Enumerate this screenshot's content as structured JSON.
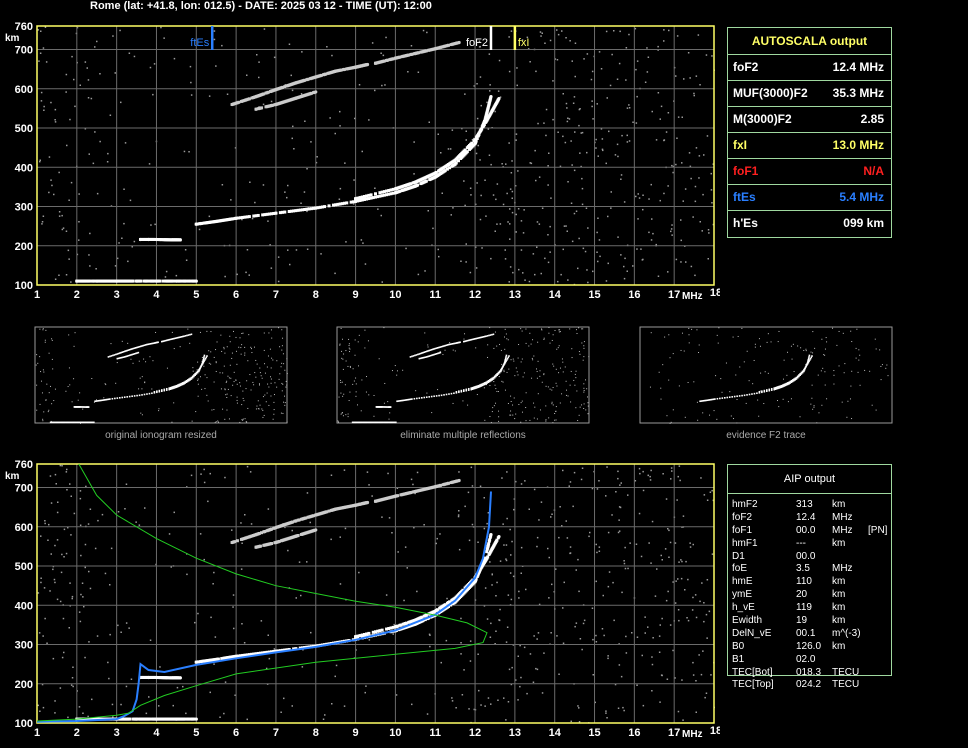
{
  "header": "Rome (lat: +41.8, lon: 012.5) - DATE: 2025 03 12 - TIME (UT): 12:00",
  "colors": {
    "frame": "#ffff66",
    "grid": "#6b6b6b",
    "panel_border": "#9fd89f",
    "blue": "#2a7fff",
    "red": "#ff2020",
    "yellow": "#ffff66",
    "green": "#22cc22"
  },
  "autoscala": {
    "title": "AUTOSCALA output",
    "rows": [
      {
        "label": "foF2",
        "value": "12.4 MHz",
        "color": "#ffffff"
      },
      {
        "label": "MUF(3000)F2",
        "value": "35.3 MHz",
        "color": "#ffffff"
      },
      {
        "label": "M(3000)F2",
        "value": "2.85",
        "color": "#ffffff"
      },
      {
        "label": "fxI",
        "value": "13.0 MHz",
        "color": "#ffff66"
      },
      {
        "label": "foF1",
        "value": "N/A",
        "color": "#ff2020"
      },
      {
        "label": "ftEs",
        "value": "5.4 MHz",
        "color": "#2a7fff"
      },
      {
        "label": "h'Es",
        "value": "099    km",
        "color": "#ffffff"
      }
    ]
  },
  "aip": {
    "title": "AIP output",
    "rows": [
      [
        "hmF2",
        "313",
        "km",
        ""
      ],
      [
        "foF2",
        "12.4",
        "MHz",
        ""
      ],
      [
        "foF1",
        "00.0",
        "MHz",
        "[PN]"
      ],
      [
        "hmF1",
        "---",
        "km",
        ""
      ],
      [
        "D1",
        "00.0",
        "",
        ""
      ],
      [
        "foE",
        "3.5",
        "MHz",
        ""
      ],
      [
        "hmE",
        "110",
        "km",
        ""
      ],
      [
        "ymE",
        "20",
        "km",
        ""
      ],
      [
        "h_vE",
        "119",
        "km",
        ""
      ],
      [
        "Ewidth",
        "19",
        "km",
        ""
      ],
      [
        "DelN_vE",
        "00.1",
        "m^(-3)",
        ""
      ],
      [
        "B0",
        "126.0",
        "km",
        ""
      ],
      [
        "B1",
        "02.0",
        "",
        ""
      ],
      [
        "TEC[Bot]",
        "018.3",
        "TECU",
        ""
      ],
      [
        "TEC[Top]",
        "024.2",
        "TECU",
        ""
      ]
    ]
  },
  "thumbnails": {
    "labels": [
      "original ionogram resized",
      "eliminate multiple reflections",
      "evidence F2 trace"
    ]
  },
  "chart_data": [
    {
      "type": "scatter",
      "title": "",
      "xlabel": "MHz",
      "ylabel": "km",
      "xlim": [
        1,
        18
      ],
      "ylim": [
        100,
        760
      ],
      "xticks": [
        1,
        2,
        3,
        4,
        5,
        6,
        7,
        8,
        9,
        10,
        11,
        12,
        13,
        14,
        15,
        16,
        17,
        18
      ],
      "yticks": [
        100,
        200,
        300,
        400,
        500,
        600,
        700,
        760
      ],
      "grid": true,
      "markers": [
        {
          "name": "ftEs",
          "x": 5.4,
          "color": "#2a7fff"
        },
        {
          "name": "foF2",
          "x": 12.4,
          "color": "#ffffff"
        },
        {
          "name": "fxI",
          "x": 13.0,
          "color": "#ffff66"
        }
      ],
      "series": [
        {
          "color": "#ffffff",
          "points": [
            [
              3.6,
              216
            ],
            [
              3.8,
              216
            ],
            [
              4.0,
              216
            ],
            [
              4.4,
              215
            ],
            [
              4.6,
              215
            ]
          ]
        },
        {
          "color": "#ffffff",
          "points": [
            [
              2.0,
              110
            ],
            [
              2.5,
              110
            ],
            [
              3.0,
              110
            ],
            [
              3.5,
              110
            ],
            [
              4.0,
              110
            ],
            [
              4.5,
              110
            ],
            [
              5.0,
              110
            ]
          ]
        },
        {
          "color": "#ffffff",
          "points": [
            [
              5.0,
              255
            ],
            [
              5.5,
              262
            ],
            [
              6.0,
              270
            ],
            [
              7.0,
              283
            ],
            [
              8.0,
              296
            ],
            [
              9.0,
              313
            ],
            [
              10.0,
              335
            ],
            [
              10.5,
              352
            ],
            [
              11.0,
              375
            ],
            [
              11.5,
              408
            ],
            [
              12.0,
              460
            ],
            [
              12.25,
              520
            ],
            [
              12.4,
              580
            ]
          ]
        },
        {
          "color": "#ffffff",
          "points": [
            [
              9.0,
              320
            ],
            [
              10.0,
              345
            ],
            [
              10.5,
              362
            ],
            [
              11.0,
              385
            ],
            [
              11.5,
              418
            ],
            [
              12.0,
              470
            ],
            [
              12.3,
              520
            ],
            [
              12.6,
              575
            ]
          ]
        },
        {
          "color": "#cccccc",
          "points": [
            [
              5.9,
              560
            ],
            [
              6.5,
              580
            ],
            [
              7.0,
              598
            ],
            [
              7.5,
              615
            ],
            [
              8.0,
              630
            ],
            [
              8.5,
              645
            ],
            [
              9.0,
              655
            ],
            [
              9.3,
              662
            ]
          ]
        },
        {
          "color": "#cccccc",
          "points": [
            [
              6.5,
              548
            ],
            [
              7.0,
              560
            ],
            [
              7.5,
              576
            ],
            [
              8.0,
              592
            ]
          ]
        },
        {
          "color": "#cccccc",
          "points": [
            [
              9.5,
              665
            ],
            [
              10.0,
              678
            ],
            [
              10.5,
              690
            ],
            [
              11.0,
              702
            ],
            [
              11.6,
              718
            ]
          ]
        }
      ]
    },
    {
      "type": "scatter",
      "title": "",
      "xlabel": "MHz",
      "ylabel": "km",
      "xlim": [
        1,
        18
      ],
      "ylim": [
        100,
        760
      ],
      "xticks": [
        1,
        2,
        3,
        4,
        5,
        6,
        7,
        8,
        9,
        10,
        11,
        12,
        13,
        14,
        15,
        16,
        17,
        18
      ],
      "yticks": [
        100,
        200,
        300,
        400,
        500,
        600,
        700,
        760
      ],
      "grid": true,
      "series": [
        {
          "color": "#ffffff",
          "points": [
            [
              3.6,
              216
            ],
            [
              3.8,
              216
            ],
            [
              4.0,
              216
            ],
            [
              4.4,
              215
            ],
            [
              4.6,
              215
            ]
          ]
        },
        {
          "color": "#ffffff",
          "points": [
            [
              2.0,
              110
            ],
            [
              2.5,
              110
            ],
            [
              3.0,
              110
            ],
            [
              3.5,
              110
            ],
            [
              4.0,
              110
            ],
            [
              4.5,
              110
            ],
            [
              5.0,
              110
            ]
          ]
        },
        {
          "color": "#ffffff",
          "points": [
            [
              5.0,
              255
            ],
            [
              5.5,
              262
            ],
            [
              6.0,
              270
            ],
            [
              7.0,
              283
            ],
            [
              8.0,
              296
            ],
            [
              9.0,
              313
            ],
            [
              10.0,
              335
            ],
            [
              10.5,
              352
            ],
            [
              11.0,
              375
            ],
            [
              11.5,
              408
            ],
            [
              12.0,
              460
            ],
            [
              12.25,
              520
            ],
            [
              12.4,
              580
            ]
          ]
        },
        {
          "color": "#ffffff",
          "points": [
            [
              9.0,
              320
            ],
            [
              10.0,
              345
            ],
            [
              10.5,
              362
            ],
            [
              11.0,
              385
            ],
            [
              11.5,
              418
            ],
            [
              12.0,
              470
            ],
            [
              12.3,
              520
            ],
            [
              12.6,
              575
            ]
          ]
        },
        {
          "color": "#cccccc",
          "points": [
            [
              5.9,
              560
            ],
            [
              6.5,
              580
            ],
            [
              7.0,
              598
            ],
            [
              7.5,
              615
            ],
            [
              8.0,
              630
            ],
            [
              8.5,
              645
            ],
            [
              9.0,
              655
            ],
            [
              9.3,
              662
            ]
          ]
        },
        {
          "color": "#cccccc",
          "points": [
            [
              6.5,
              548
            ],
            [
              7.0,
              560
            ],
            [
              7.5,
              576
            ],
            [
              8.0,
              592
            ]
          ]
        },
        {
          "color": "#cccccc",
          "points": [
            [
              9.5,
              665
            ],
            [
              10.0,
              678
            ],
            [
              10.5,
              690
            ],
            [
              11.0,
              702
            ],
            [
              11.6,
              718
            ]
          ]
        },
        {
          "color": "#2a7fff",
          "points": [
            [
              1.0,
              103
            ],
            [
              2.0,
              105
            ],
            [
              3.0,
              110
            ],
            [
              3.2,
              118
            ],
            [
              3.4,
              130
            ],
            [
              3.5,
              160
            ],
            [
              3.55,
              200
            ],
            [
              3.6,
              250
            ],
            [
              3.8,
              235
            ],
            [
              4.2,
              230
            ],
            [
              5.0,
              248
            ],
            [
              6.0,
              265
            ],
            [
              7.0,
              280
            ],
            [
              8.0,
              294
            ],
            [
              9.0,
              312
            ],
            [
              10.0,
              336
            ],
            [
              11.0,
              376
            ],
            [
              11.5,
              412
            ],
            [
              12.0,
              470
            ],
            [
              12.2,
              520
            ],
            [
              12.35,
              600
            ],
            [
              12.4,
              690
            ]
          ]
        },
        {
          "color": "#22cc22",
          "points": [
            [
              2.05,
              760
            ],
            [
              2.5,
              680
            ],
            [
              3.0,
              630
            ],
            [
              4.0,
              570
            ],
            [
              5.0,
              520
            ],
            [
              6.0,
              480
            ],
            [
              7.0,
              450
            ],
            [
              8.0,
              430
            ],
            [
              9.0,
              410
            ],
            [
              10.0,
              395
            ],
            [
              11.0,
              375
            ],
            [
              11.8,
              355
            ],
            [
              12.3,
              330
            ],
            [
              12.2,
              305
            ],
            [
              11.5,
              290
            ],
            [
              10.0,
              275
            ],
            [
              8.0,
              255
            ],
            [
              6.0,
              225
            ],
            [
              5.0,
              195
            ],
            [
              4.2,
              170
            ],
            [
              3.6,
              145
            ],
            [
              3.3,
              125
            ],
            [
              3.0,
              120
            ],
            [
              2.0,
              110
            ],
            [
              1.0,
              105
            ]
          ]
        }
      ]
    }
  ]
}
